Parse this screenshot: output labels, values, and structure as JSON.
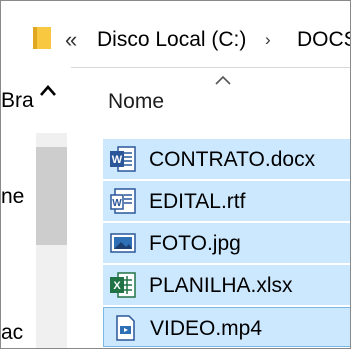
{
  "address": {
    "sep1": "«",
    "crumb1": "Disco Local (C:)",
    "sep2": "›",
    "crumb2": "DOCS"
  },
  "nav": {
    "fragments": [
      "Bra",
      "ne",
      "ac"
    ]
  },
  "columns": {
    "name": "Nome"
  },
  "files": [
    {
      "name": "CONTRATO.docx",
      "icon": "word-document-icon"
    },
    {
      "name": "EDITAL.rtf",
      "icon": "rtf-document-icon"
    },
    {
      "name": "FOTO.jpg",
      "icon": "image-file-icon"
    },
    {
      "name": "PLANILHA.xlsx",
      "icon": "excel-spreadsheet-icon"
    },
    {
      "name": "VIDEO.mp4",
      "icon": "video-file-icon"
    }
  ],
  "colors": {
    "selection": "#cce8ff",
    "focus_border": "#7ab8e6",
    "folder": "#f8c840",
    "word": "#2b579a",
    "excel": "#217346"
  }
}
